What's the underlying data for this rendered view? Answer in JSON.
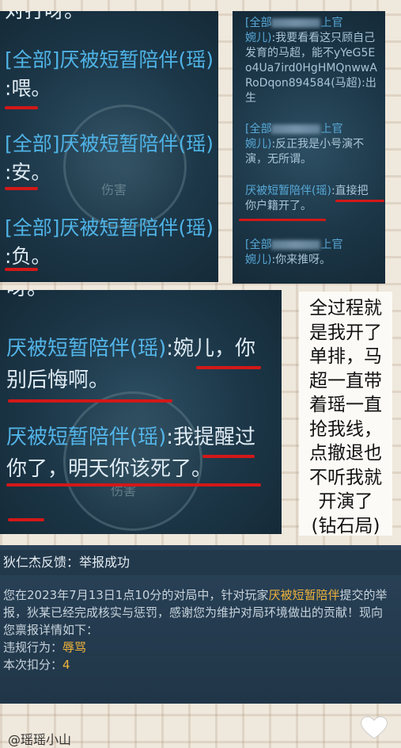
{
  "panel1": {
    "top_fragment": "对打呀。",
    "lines": [
      {
        "sender": "[全部]厌被短暂陪伴(瑶)",
        "message": ":喂。"
      },
      {
        "sender": "[全部]厌被短暂陪伴(瑶)",
        "message": ":安。"
      },
      {
        "sender": "[全部]厌被短暂陪伴(瑶)",
        "message": ":负。"
      }
    ],
    "skill_label": "伤害"
  },
  "panel2": {
    "lines": [
      {
        "sender": "[全部",
        "mid": "上官",
        "sender2": "婉儿)",
        "message": ":我要看看这只顾自己发育的马超，能不yYeG5Eo4Ua7ird0HgHMQnwwARoDqon894584(马超):出生"
      },
      {
        "sender": "[全部",
        "mid": "上官",
        "sender2": "婉儿)",
        "message": ":反正我是小号演不演，无所谓。"
      },
      {
        "sender": "厌被短暂陪伴(瑶)",
        "message": ":直接把你户籍开了。"
      },
      {
        "sender": "[全部",
        "mid": "上官",
        "sender2": "婉儿)",
        "message": ":你来推呀。"
      }
    ]
  },
  "panel3": {
    "top_fragment": "呀。",
    "lines": [
      {
        "sender": "厌被短暂陪伴(瑶)",
        "message": ":婉儿，你别后悔啊。"
      },
      {
        "sender": "厌被短暂陪伴(瑶)",
        "message": ":我提醒过你了，明天你该死了。"
      }
    ],
    "skill_label": "伤害"
  },
  "caption": {
    "lines": [
      "全过程就",
      "是我开了",
      "单排，马",
      "超一直带",
      "着瑶一直",
      "抢我线，",
      "点撤退也",
      "不听我就",
      "开演了",
      "(钻石局)"
    ]
  },
  "notice": {
    "title": "狄仁杰反馈：举报成功",
    "body_pre": "您在2023年7月13日1点10分的对局中，针对玩家",
    "player": "厌被短暂陪伴",
    "body_post": "提交的举报，狄某已经完成核实与惩罚，感谢您为维护对局环境做出的贡献！现向您禀报详情如下：",
    "violation_label": "违规行为：",
    "violation_value": "辱骂",
    "deduct_label": "本次扣分：",
    "deduct_value": "4"
  },
  "footer": {
    "username": "@瑶瑶小山"
  },
  "colors": {
    "chat_sender": "#4fb3e6",
    "chat_message": "#dfeaf2",
    "underline": "#d31818",
    "highlight": "#f0b33a"
  },
  "icons": [
    "heart-icon"
  ]
}
